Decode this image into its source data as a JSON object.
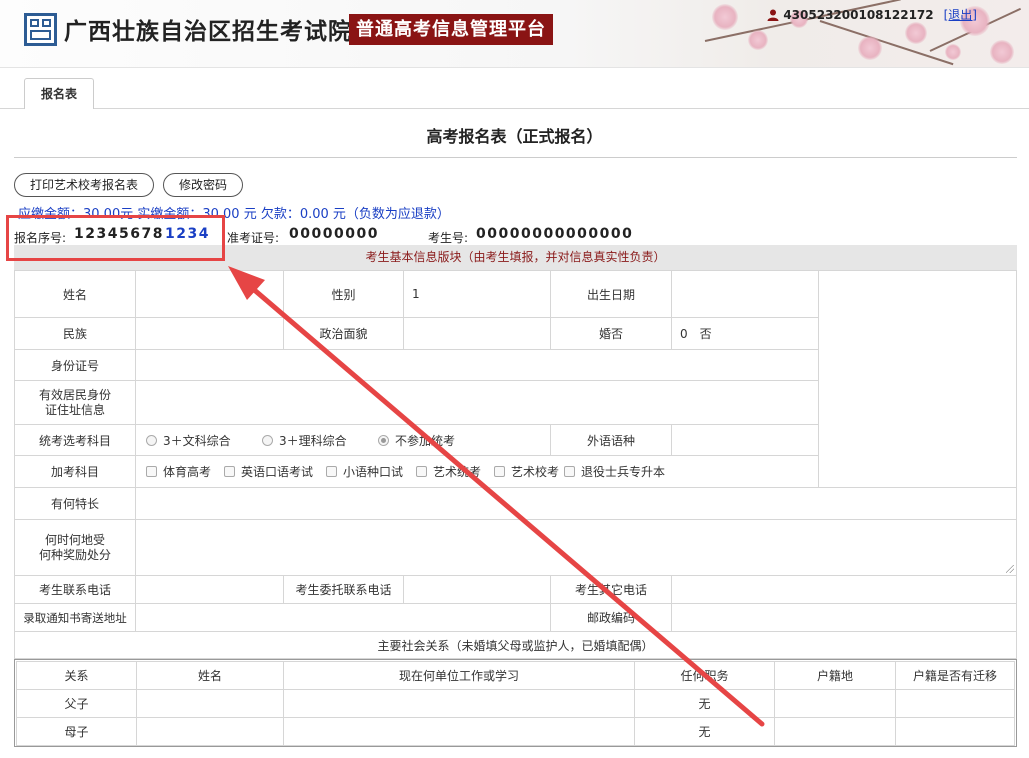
{
  "header": {
    "org_name": "广西壮族自治区招生考试院",
    "platform_name": "普通高考信息管理平台",
    "user_id": "430523200108122172",
    "logout_label": "[退出]"
  },
  "tabs": [
    {
      "label": "报名表"
    }
  ],
  "form_title": "高考报名表（正式报名）",
  "buttons": {
    "print_art": "打印艺术校考报名表",
    "change_password": "修改密码"
  },
  "fee_line": "应缴金额：30.00元 实缴金额：30.00 元 欠款：0.00 元（负数为应退款）",
  "ids": {
    "reg_no_label": "报名序号:",
    "reg_no_value": "12345678",
    "reg_no_suffix": "1234",
    "ticket_label": "准考证号:",
    "ticket_value": "00000000",
    "exam_no_label": "考生号:",
    "exam_no_value": "00000000000000"
  },
  "section_title": "考生基本信息版块（由考生填报，并对信息真实性负责）",
  "fields": {
    "name_label": "姓名",
    "name_value": "",
    "gender_label": "性别",
    "gender_value": "1",
    "birth_label": "出生日期",
    "birth_value": "",
    "ethnicity_label": "民族",
    "ethnicity_value": "",
    "political_label": "政治面貌",
    "political_value": "",
    "marital_label": "婚否",
    "marital_value": "0　否",
    "id_label": "身份证号",
    "id_value": "",
    "residence_label_1": "有效居民身份",
    "residence_label_2": "证住址信息",
    "residence_value": "",
    "subject_label": "统考选考科目",
    "subject_options": [
      "3＋文科综合",
      "3＋理科综合",
      "不参加统考"
    ],
    "subject_selected": "不参加统考",
    "foreign_lang_label": "外语语种",
    "foreign_lang_value": "",
    "extra_label": "加考科目",
    "extra_options": [
      "体育高考",
      "英语口语考试",
      "小语种口试",
      "艺术统考",
      "艺术校考",
      "退役士兵专升本"
    ],
    "talent_label": "有何特长",
    "talent_value": "",
    "award_label_1": "何时何地受",
    "award_label_2": "何种奖励处分",
    "award_value": "",
    "phone_label": "考生联系电话",
    "phone_value": "",
    "proxy_phone_label": "考生委托联系电话",
    "proxy_phone_value": "",
    "other_phone_label": "考生其它电话",
    "other_phone_value": "",
    "address_label": "录取通知书寄送地址",
    "address_value": "",
    "postcode_label": "邮政编码",
    "postcode_value": ""
  },
  "relations": {
    "title": "主要社会关系（未婚填父母或监护人，已婚填配偶）",
    "columns": [
      "关系",
      "姓名",
      "现在何单位工作或学习",
      "任何职务",
      "户籍地",
      "户籍是否有迁移"
    ],
    "rows": [
      [
        "父子",
        "",
        "",
        "无",
        "",
        ""
      ],
      [
        "母子",
        "",
        "",
        "无",
        "",
        ""
      ]
    ]
  },
  "colors": {
    "accent_blue": "#1a3fc4",
    "brand_red": "#8a1414",
    "annotation_red": "#e64545"
  },
  "icons": {
    "user": "user-icon"
  }
}
